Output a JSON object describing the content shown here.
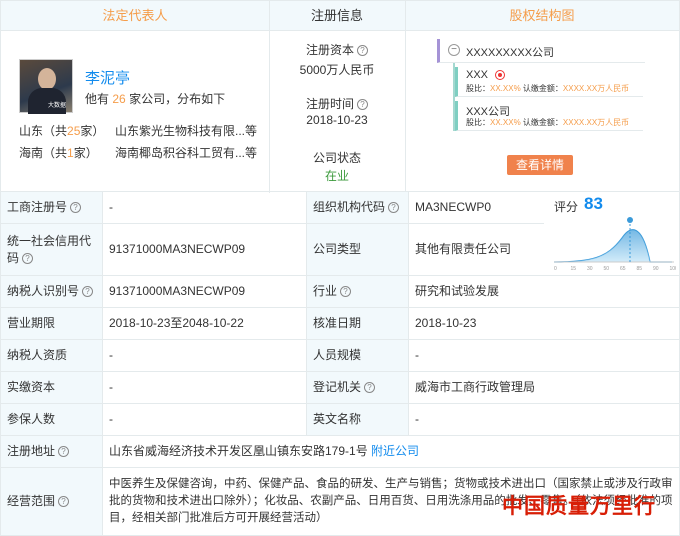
{
  "header": {
    "col1": "法定代表人",
    "col2": "注册信息",
    "col3": "股权结构图"
  },
  "legal_rep": {
    "name": "李泥亭",
    "companies_prefix": "他有",
    "companies_count": "26",
    "companies_suffix": "家公司，分布如下",
    "regions": [
      {
        "province": "山东（共",
        "count": "25",
        "unit": "家）",
        "desc": "山东紫光生物科技有限...等"
      },
      {
        "province": "海南（共",
        "count": "1",
        "unit": "家）",
        "desc": "海南椰岛积谷科工贸有...等"
      }
    ]
  },
  "reg_info": {
    "capital_label": "注册资本",
    "capital_value": "5000万人民币",
    "date_label": "注册时间",
    "date_value": "2018-10-23",
    "status_label": "公司状态",
    "status_value": "在业"
  },
  "equity": {
    "root": "XXXXXXXXX公司",
    "node1_name": "XXX",
    "node1_detail_a": "股比：",
    "node1_pct": "XX.XX%",
    "node1_detail_b": " 认缴金额：",
    "node1_amt": "XXXX.XX万人民币",
    "node2_name": "XXX公司",
    "node2_pct": "XX.XX%",
    "node2_amt": "XXXX.XX万人民币",
    "button": "查看详情"
  },
  "score": {
    "label": "评分",
    "value": "83",
    "ticks": [
      "0",
      "15",
      "30",
      "50",
      "65",
      "85",
      "90",
      "100"
    ]
  },
  "rows": {
    "r1": {
      "l1": "工商注册号",
      "v1": "-",
      "l2": "组织机构代码",
      "v2": "MA3NECWP0"
    },
    "r2": {
      "l1": "统一社会信用代码",
      "v1": "91371000MA3NECWP09",
      "l2": "公司类型",
      "v2": "其他有限责任公司"
    },
    "r3": {
      "l1": "纳税人识别号",
      "v1": "91371000MA3NECWP09",
      "l2": "行业",
      "v2": "研究和试验发展"
    },
    "r4": {
      "l1": "营业期限",
      "v1": "2018-10-23至2048-10-22",
      "l2": "核准日期",
      "v2": "2018-10-23"
    },
    "r5": {
      "l1": "纳税人资质",
      "v1": "-",
      "l2": "人员规模",
      "v2": "-"
    },
    "r6": {
      "l1": "实缴资本",
      "v1": "-",
      "l2": "登记机关",
      "v2": "威海市工商行政管理局"
    },
    "r7": {
      "l1": "参保人数",
      "v1": "-",
      "l2": "英文名称",
      "v2": "-"
    },
    "r8": {
      "l1": "注册地址",
      "v1": "山东省威海经济技术开发区凰山镇东安路179-1号",
      "link": "附近公司"
    },
    "r9": {
      "l1": "经营范围",
      "v1": "中医养生及保健咨询，中药、保健产品、食品的研发、生产与销售；货物或技术进出口（国家禁止或涉及行政审批的货物和技术进出口除外）；化妆品、农副产品、日用百货、日用洗涤用品的批发、零售。（依法须经批准的项目，经相关部门批准后方可开展经营活动）"
    }
  },
  "watermark": "中国质量万里行",
  "colors": {
    "accent": "#f59d4b",
    "link": "#128bed",
    "label_bg": "#f2f9fc",
    "status": "#3c9a3c",
    "button": "#f0824c"
  }
}
